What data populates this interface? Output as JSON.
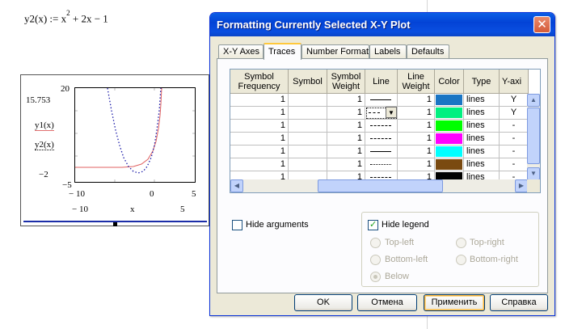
{
  "worksheet": {
    "formula": {
      "lhs": "y2(x) := x",
      "exponent": "2",
      "rhs": " + 2x − 1"
    },
    "plot": {
      "y_max_label": "20",
      "y_mark_label": "15.753",
      "y_min_label": "−2",
      "y_low_label": "−5",
      "trace1_label": "y1(x)",
      "trace2_label": "y2(x)",
      "x_left_tick": "− 10",
      "x_zero_tick": "0",
      "x_right_tick": "5",
      "x_min_label": "− 10",
      "x_axis_label": "x",
      "x_max_label": "5",
      "y1_color": "#e06060",
      "y2_color": "#1a1aa8"
    }
  },
  "dialog": {
    "title": "Formatting Currently Selected X-Y Plot",
    "close_glyph": "✕",
    "tabs": [
      "X-Y Axes",
      "Traces",
      "Number Format",
      "Labels",
      "Defaults"
    ],
    "active_tab": "Traces",
    "traces": {
      "columns": [
        "Symbol Frequency",
        "Symbol",
        "Symbol Weight",
        "Line",
        "Line Weight",
        "Color",
        "Type",
        "Y-axi"
      ],
      "rows": [
        {
          "freq": "1",
          "symbol": "",
          "sweight": "1",
          "line": "solid",
          "lweight": "1",
          "color": "#1a75c4",
          "type": "lines",
          "yaxis": "Y"
        },
        {
          "freq": "1",
          "symbol": "",
          "sweight": "1",
          "line": "dash-dot",
          "lweight": "1",
          "color": "#00f080",
          "type": "lines",
          "yaxis": "Y"
        },
        {
          "freq": "1",
          "symbol": "",
          "sweight": "1",
          "line": "dash",
          "lweight": "1",
          "color": "#00ff00",
          "type": "lines",
          "yaxis": "-"
        },
        {
          "freq": "1",
          "symbol": "",
          "sweight": "1",
          "line": "dash-dot",
          "lweight": "1",
          "color": "#ff00ff",
          "type": "lines",
          "yaxis": "-"
        },
        {
          "freq": "1",
          "symbol": "",
          "sweight": "1",
          "line": "solid",
          "lweight": "1",
          "color": "#00ffff",
          "type": "lines",
          "yaxis": "-"
        },
        {
          "freq": "1",
          "symbol": "",
          "sweight": "1",
          "line": "dotted",
          "lweight": "1",
          "color": "#7a4a10",
          "type": "lines",
          "yaxis": "-"
        },
        {
          "freq": "1",
          "symbol": "",
          "sweight": "1",
          "line": "dash",
          "lweight": "1",
          "color": "#000000",
          "type": "lines",
          "yaxis": "-"
        }
      ]
    },
    "hide_arguments": {
      "label": "Hide arguments",
      "checked": false
    },
    "hide_legend": {
      "label": "Hide legend",
      "checked": true
    },
    "legend_positions": [
      {
        "label": "Top-left",
        "selected": false
      },
      {
        "label": "Top-right",
        "selected": false
      },
      {
        "label": "Bottom-left",
        "selected": false
      },
      {
        "label": "Bottom-right",
        "selected": false
      },
      {
        "label": "Below",
        "selected": true
      }
    ],
    "buttons": {
      "ok": "OK",
      "cancel": "Отмена",
      "apply": "Применить",
      "help": "Справка"
    }
  }
}
